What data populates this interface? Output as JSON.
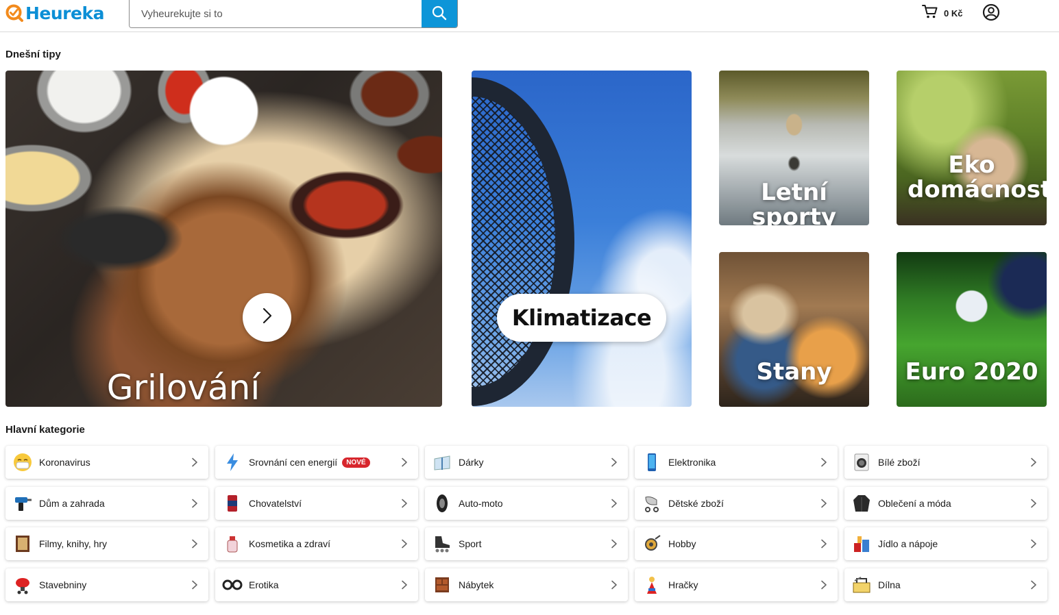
{
  "header": {
    "brand": "Heureka",
    "search_placeholder": "Vyheurekujte si to",
    "cart_amount": "0 Kč",
    "colors": {
      "brand_blue": "#0c8fd6",
      "brand_orange": "#f28a1c",
      "search_button": "#0d95d8"
    }
  },
  "tips": {
    "title": "Dnešní tipy",
    "tiles": [
      {
        "label": "Grilování"
      },
      {
        "label": "Klimatizace"
      },
      {
        "label": "Letní sporty"
      },
      {
        "label": "Eko domácnost"
      },
      {
        "label": "Stany"
      },
      {
        "label": "Euro 2020"
      }
    ]
  },
  "categories": {
    "title": "Hlavní kategorie",
    "badge_new": "NOVÉ",
    "items": [
      {
        "label": "Koronavirus",
        "icon": "mask-face-icon"
      },
      {
        "label": "Srovnání cen energií",
        "icon": "lightning-icon"
      },
      {
        "label": "Dárky",
        "icon": "gift-icon"
      },
      {
        "label": "Elektronika",
        "icon": "smartphone-icon"
      },
      {
        "label": "Bílé zboží",
        "icon": "washing-machine-icon"
      },
      {
        "label": "Dům a zahrada",
        "icon": "drill-icon"
      },
      {
        "label": "Chovatelství",
        "icon": "pet-food-icon"
      },
      {
        "label": "Auto-moto",
        "icon": "tire-icon"
      },
      {
        "label": "Dětské zboží",
        "icon": "stroller-icon"
      },
      {
        "label": "Oblečení a móda",
        "icon": "jacket-icon"
      },
      {
        "label": "Filmy, knihy, hry",
        "icon": "book-icon"
      },
      {
        "label": "Kosmetika a zdraví",
        "icon": "cosmetics-icon"
      },
      {
        "label": "Sport",
        "icon": "inline-skate-icon"
      },
      {
        "label": "Hobby",
        "icon": "fishing-reel-icon"
      },
      {
        "label": "Jídlo a nápoje",
        "icon": "food-drink-icon"
      },
      {
        "label": "Stavebniny",
        "icon": "concrete-mixer-icon"
      },
      {
        "label": "Erotika",
        "icon": "handcuffs-icon"
      },
      {
        "label": "Nábytek",
        "icon": "cabinet-icon"
      },
      {
        "label": "Hračky",
        "icon": "toy-icon"
      },
      {
        "label": "Dílna",
        "icon": "toolbox-icon"
      }
    ]
  }
}
